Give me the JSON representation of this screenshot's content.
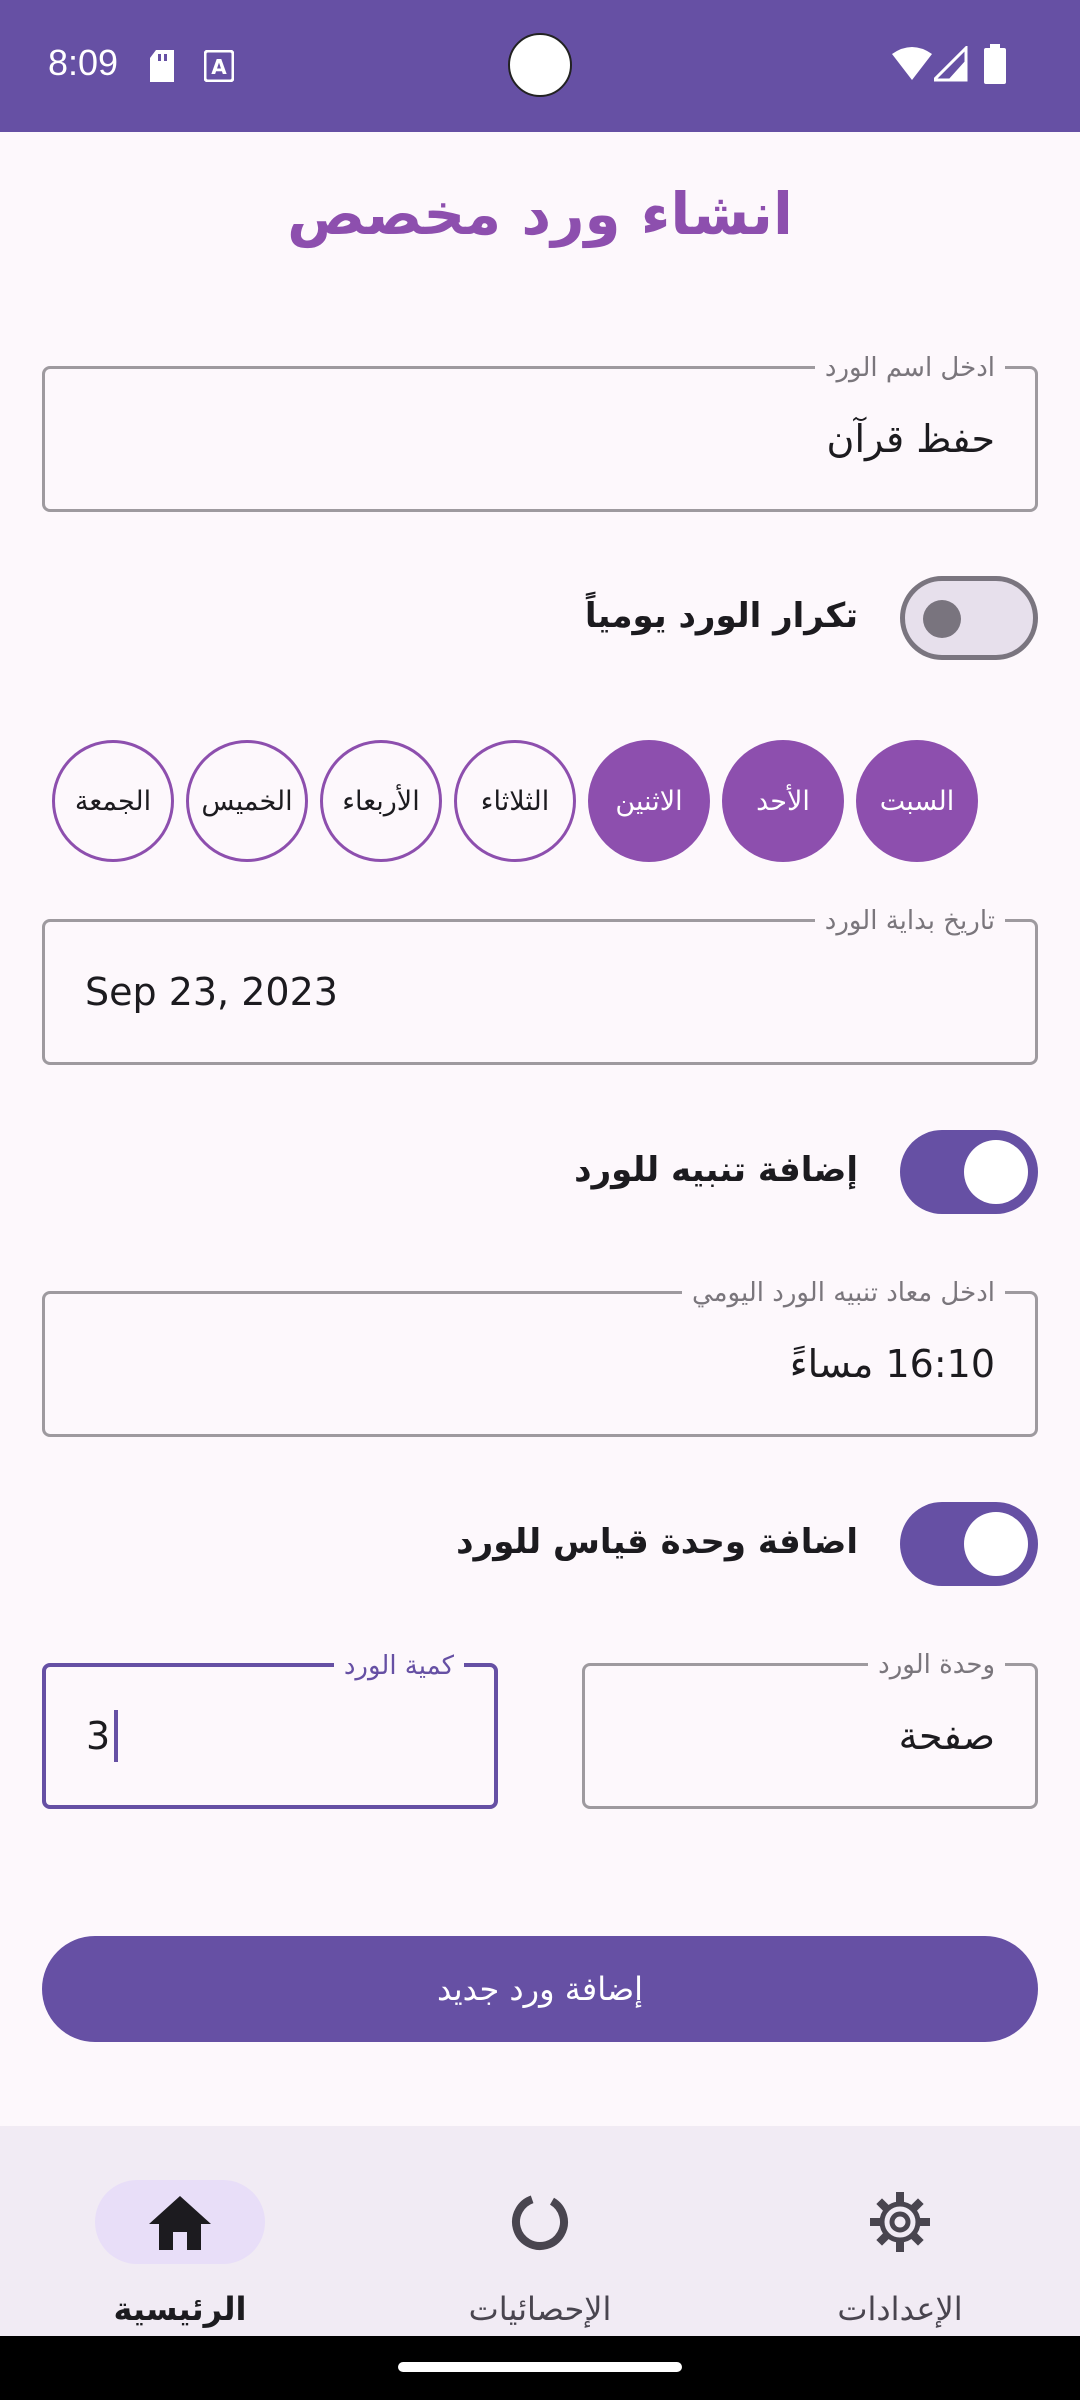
{
  "status_bar": {
    "time": "8:09",
    "background": "#6650a4"
  },
  "page": {
    "title": "انشاء ورد مخصص"
  },
  "wird_name": {
    "label": "ادخل اسم الورد",
    "value": "حفظ قرآن"
  },
  "daily_repeat": {
    "label": "تكرار الورد يومياً",
    "enabled": false
  },
  "days": [
    {
      "label": "السبت",
      "selected": true
    },
    {
      "label": "الأحد",
      "selected": true
    },
    {
      "label": "الاثنين",
      "selected": true
    },
    {
      "label": "الثلاثاء",
      "selected": false
    },
    {
      "label": "الأربعاء",
      "selected": false
    },
    {
      "label": "الخميس",
      "selected": false
    },
    {
      "label": "الجمعة",
      "selected": false
    }
  ],
  "start_date": {
    "label": "تاريخ بداية الورد",
    "value": "Sep 23, 2023"
  },
  "reminder": {
    "label": "إضافة تنبيه للورد",
    "enabled": true
  },
  "reminder_time": {
    "label": "ادخل معاد تنبيه الورد اليومي",
    "value": "16:10 مساءً"
  },
  "measure_unit_toggle": {
    "label": "اضافة وحدة قياس للورد",
    "enabled": true
  },
  "unit": {
    "label": "وحدة الورد",
    "value": "صفحة"
  },
  "quantity": {
    "label": "كمية الورد",
    "value": "3"
  },
  "submit_label": "إضافة ورد جديد",
  "nav": {
    "items": [
      {
        "label": "الرئيسية",
        "icon": "home-icon",
        "active": true
      },
      {
        "label": "الإحصائيات",
        "icon": "stats-icon",
        "active": false
      },
      {
        "label": "الإعدادات",
        "icon": "gear-icon",
        "active": false
      }
    ]
  },
  "colors": {
    "primary": "#6650a4",
    "accent": "#8d4fae",
    "background": "#fdf8fc"
  }
}
